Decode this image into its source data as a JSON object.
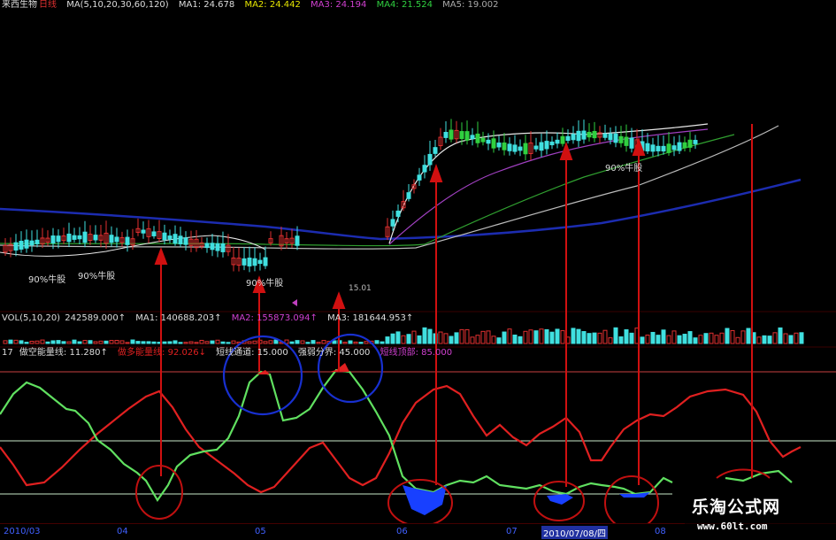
{
  "header": {
    "stock_name": "来西生物",
    "period": "日线",
    "ma_params": "MA(5,10,20,30,60,120)",
    "ma1": "MA1: 24.678",
    "ma2": "MA2: 24.442",
    "ma3": "MA3: 24.194",
    "ma4": "MA4: 21.524",
    "ma5": "MA5: 19.002"
  },
  "price_annotations": {
    "bull_1": "90%牛股",
    "bull_2": "90%牛股",
    "bull_3": "90%牛股",
    "bull_4": "90%牛股",
    "mid_value": "15.01"
  },
  "volume_panel": {
    "params": "VOL(5,10,20)",
    "vol": "242589.000↑",
    "ma1": "MA1: 140688.203↑",
    "ma2": "MA2: 155873.094↑",
    "ma3": "MA3: 181644.953↑"
  },
  "indicator_panel": {
    "id": "17",
    "short_energy": "做空能量线: 11.280↑",
    "long_energy": "做多能量线: 92.026↓",
    "short_channel": "短线通道: 15.000",
    "strength": "强弱分界: 45.000",
    "long_channel": "短线顶部: 85.000"
  },
  "date_axis": {
    "d1": "2010/03",
    "d2": "04",
    "d3": "05",
    "d4": "06",
    "d5": "07",
    "d6": "2010/07/08/四",
    "d7": "08"
  },
  "watermark": {
    "name": "乐淘公式网",
    "url": "www.60lt.com"
  },
  "colors": {
    "background": "#000000",
    "up_candle": "#e03030",
    "down_candle": "#40e0e0",
    "green_candle": "#30d040",
    "arrow": "#d01010",
    "circle": "#c01010",
    "blue_circle": "#1830d0",
    "ma_blue": "#1c2cb0",
    "ma_white": "#d8d8d8",
    "ma_green": "#30a030",
    "ma_purple": "#a040c0",
    "energy_red": "#e02020",
    "energy_green": "#60e060",
    "level_line": "#c8e8c8"
  }
}
